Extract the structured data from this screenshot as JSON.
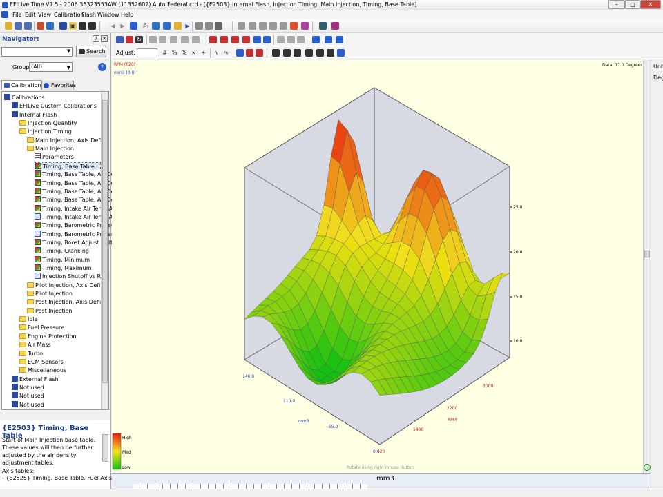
{
  "window": {
    "title": "EFILive Tune V7.5 - 2006 35323553AW (11352602) Auto Federal.ctd - [{E2503} Internal Flash, Injection Timing, Main Injection, Timing, Base Table]"
  },
  "menu": [
    "File",
    "Edit",
    "View",
    "Calibration",
    "Flash",
    "Window",
    "Help"
  ],
  "navigator": {
    "label": "Navigator:",
    "search_label": "Search",
    "group_label": "Group:",
    "group_value": "(All)",
    "tabs": [
      "Calibrations",
      "Favorites"
    ]
  },
  "tree": [
    {
      "label": "Calibrations",
      "indent": 0,
      "icon": "calib"
    },
    {
      "label": "EFILive Custom Calibrations",
      "indent": 1,
      "icon": "chip"
    },
    {
      "label": "Internal Flash",
      "indent": 1,
      "icon": "chip"
    },
    {
      "label": "Injection Quantity",
      "indent": 2,
      "icon": "folder"
    },
    {
      "label": "Injection Timing",
      "indent": 2,
      "icon": "folder"
    },
    {
      "label": "Main Injection, Axis Define",
      "indent": 3,
      "icon": "folder"
    },
    {
      "label": "Main Injection",
      "indent": 3,
      "icon": "folder"
    },
    {
      "label": "Parameters",
      "indent": 4,
      "icon": "table"
    },
    {
      "label": "Timing, Base Table",
      "indent": 4,
      "icon": "cube",
      "selected": true
    },
    {
      "label": "Timing, Base Table, Air De",
      "indent": 4,
      "icon": "cube"
    },
    {
      "label": "Timing, Base Table, Air De",
      "indent": 4,
      "icon": "cube"
    },
    {
      "label": "Timing, Base Table, Air De",
      "indent": 4,
      "icon": "cube"
    },
    {
      "label": "Timing, Base Table, Air De",
      "indent": 4,
      "icon": "cube"
    },
    {
      "label": "Timing, Intake Air Temp Ad",
      "indent": 4,
      "icon": "cube"
    },
    {
      "label": "Timing, Intake Air Temp Ad",
      "indent": 4,
      "icon": "graph"
    },
    {
      "label": "Timing, Barometric Pressu",
      "indent": 4,
      "icon": "cube"
    },
    {
      "label": "Timing, Barometric Pressu",
      "indent": 4,
      "icon": "graph"
    },
    {
      "label": "Timing, Boost Adjust Multi",
      "indent": 4,
      "icon": "cube"
    },
    {
      "label": "Timing, Cranking",
      "indent": 4,
      "icon": "cube"
    },
    {
      "label": "Timing, Minimum",
      "indent": 4,
      "icon": "cube"
    },
    {
      "label": "Timing, Maximum",
      "indent": 4,
      "icon": "cube"
    },
    {
      "label": "Injection Shutoff vs RPM",
      "indent": 4,
      "icon": "graph"
    },
    {
      "label": "Pilot Injection, Axis Define",
      "indent": 3,
      "icon": "folder"
    },
    {
      "label": "Pilot Injection",
      "indent": 3,
      "icon": "folder"
    },
    {
      "label": "Post Injection, Axis Define",
      "indent": 3,
      "icon": "folder"
    },
    {
      "label": "Post Injection",
      "indent": 3,
      "icon": "folder"
    },
    {
      "label": "Idle",
      "indent": 2,
      "icon": "folder"
    },
    {
      "label": "Fuel Pressure",
      "indent": 2,
      "icon": "folder"
    },
    {
      "label": "Engine Protection",
      "indent": 2,
      "icon": "folder"
    },
    {
      "label": "Air Mass",
      "indent": 2,
      "icon": "folder"
    },
    {
      "label": "Turbo",
      "indent": 2,
      "icon": "folder"
    },
    {
      "label": "ECM Sensors",
      "indent": 2,
      "icon": "folder"
    },
    {
      "label": "Miscellaneous",
      "indent": 2,
      "icon": "folder"
    },
    {
      "label": "External Flash",
      "indent": 1,
      "icon": "chip"
    },
    {
      "label": "Not used",
      "indent": 1,
      "icon": "chip"
    },
    {
      "label": "Not used",
      "indent": 1,
      "icon": "chip"
    },
    {
      "label": "Not used",
      "indent": 1,
      "icon": "chip"
    }
  ],
  "description": {
    "title": "{E2503} Timing, Base Table",
    "body": "Start of Main Injection base table. These values will then be further adjusted by the air density adjustment tables.",
    "axis_title": "Axis tables:",
    "axis_item": " - {E2525} Timing, Base Table, Fuel Axis"
  },
  "toolbar": {
    "adjust_label": "Adjust:"
  },
  "chart_data": {
    "type": "surface3d",
    "legend_tl1": "RPM (620)",
    "legend_tl2": "mm3 (0.0)",
    "readout": "Data: 17.0 Degrees",
    "hint": "Rotate using right mouse button",
    "rpm_ticks": [
      "620",
      "1400",
      "2200",
      "3000"
    ],
    "rpm_label": "RPM",
    "mm3_ticks": [
      "0.0",
      "55.0",
      "110.0",
      "140.0"
    ],
    "mm3_label": "mm3",
    "z_ticks": [
      "10.0",
      "15.0",
      "20.0",
      "25.0"
    ],
    "color_legend": [
      "High",
      "Med",
      "Low"
    ],
    "colors": {
      "high": "#e81e0e",
      "med": "#f0e020",
      "low": "#10c010"
    }
  },
  "bottom": {
    "axis_label": "mm3"
  },
  "right_pane": {
    "label1": "Unit",
    "label2": "Deg"
  }
}
